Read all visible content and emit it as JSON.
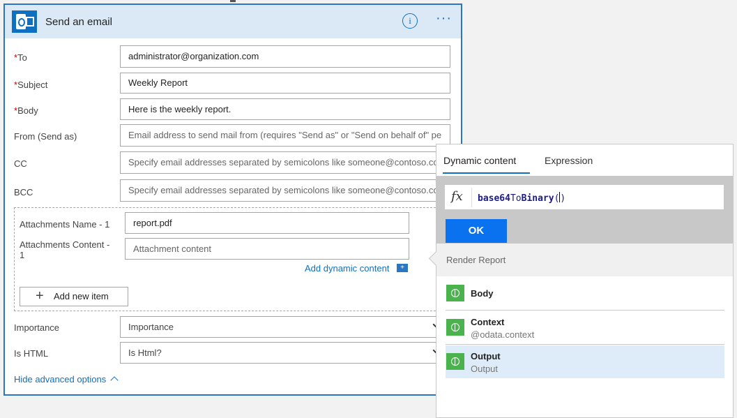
{
  "card": {
    "title": "Send an email",
    "info_glyph": "i",
    "more_glyph": "···",
    "required_mark": "*",
    "fields": {
      "to": {
        "label": "To",
        "value": "administrator@organization.com"
      },
      "subject": {
        "label": "Subject",
        "value": "Weekly Report"
      },
      "body": {
        "label": "Body",
        "value": "Here is the weekly report."
      },
      "from": {
        "label": "From (Send as)",
        "placeholder": "Email address to send mail from (requires \"Send as\" or \"Send on behalf of\" pe"
      },
      "cc": {
        "label": "CC",
        "placeholder": "Specify email addresses separated by semicolons like someone@contoso.com"
      },
      "bcc": {
        "label": "BCC",
        "placeholder": "Specify email addresses separated by semicolons like someone@contoso.com"
      }
    },
    "attachments": {
      "name_label": "Attachments Name - 1",
      "name_value": "report.pdf",
      "content_label_line1": "Attachments Content -",
      "content_label_line2": "1",
      "content_placeholder": "Attachment content",
      "add_dynamic_label": "Add dynamic content",
      "add_item_label": "Add new item"
    },
    "importance": {
      "label": "Importance",
      "placeholder": "Importance"
    },
    "is_html": {
      "label": "Is HTML",
      "placeholder": "Is Html?"
    },
    "hide_advanced": "Hide advanced options"
  },
  "panel": {
    "tabs": [
      "Dynamic content",
      "Expression"
    ],
    "active_tab": "Dynamic content",
    "fx_symbol": "fx",
    "expression_fn_part1": "base64",
    "expression_fn_part2": "To",
    "expression_fn_part3": "Binary",
    "expression_open": "(",
    "expression_close": ")",
    "ok_label": "OK",
    "section_title": "Render Report",
    "items": [
      {
        "name": "Body",
        "sub": ""
      },
      {
        "name": "Context",
        "sub": "@odata.context"
      },
      {
        "name": "Output",
        "sub": "Output",
        "selected": true
      }
    ]
  },
  "colors": {
    "accent": "#0f70c2",
    "header_bg": "#dbe9f6",
    "ok_button": "#0b72ef",
    "item_icon": "#4bb34d",
    "selected_row": "#deecf9"
  }
}
